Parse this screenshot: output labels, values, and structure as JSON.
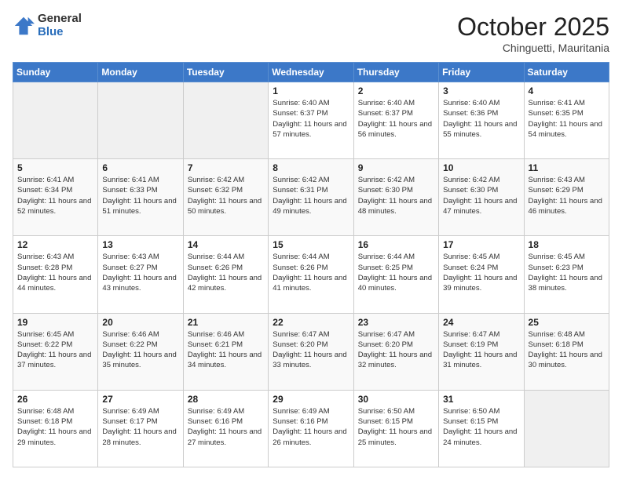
{
  "header": {
    "logo_general": "General",
    "logo_blue": "Blue",
    "month_title": "October 2025",
    "location": "Chinguetti, Mauritania"
  },
  "days_of_week": [
    "Sunday",
    "Monday",
    "Tuesday",
    "Wednesday",
    "Thursday",
    "Friday",
    "Saturday"
  ],
  "weeks": [
    [
      {
        "day": "",
        "empty": true
      },
      {
        "day": "",
        "empty": true
      },
      {
        "day": "",
        "empty": true
      },
      {
        "day": "1",
        "sunrise": "6:40 AM",
        "sunset": "6:37 PM",
        "daylight": "11 hours and 57 minutes."
      },
      {
        "day": "2",
        "sunrise": "6:40 AM",
        "sunset": "6:37 PM",
        "daylight": "11 hours and 56 minutes."
      },
      {
        "day": "3",
        "sunrise": "6:40 AM",
        "sunset": "6:36 PM",
        "daylight": "11 hours and 55 minutes."
      },
      {
        "day": "4",
        "sunrise": "6:41 AM",
        "sunset": "6:35 PM",
        "daylight": "11 hours and 54 minutes."
      }
    ],
    [
      {
        "day": "5",
        "sunrise": "6:41 AM",
        "sunset": "6:34 PM",
        "daylight": "11 hours and 52 minutes."
      },
      {
        "day": "6",
        "sunrise": "6:41 AM",
        "sunset": "6:33 PM",
        "daylight": "11 hours and 51 minutes."
      },
      {
        "day": "7",
        "sunrise": "6:42 AM",
        "sunset": "6:32 PM",
        "daylight": "11 hours and 50 minutes."
      },
      {
        "day": "8",
        "sunrise": "6:42 AM",
        "sunset": "6:31 PM",
        "daylight": "11 hours and 49 minutes."
      },
      {
        "day": "9",
        "sunrise": "6:42 AM",
        "sunset": "6:30 PM",
        "daylight": "11 hours and 48 minutes."
      },
      {
        "day": "10",
        "sunrise": "6:42 AM",
        "sunset": "6:30 PM",
        "daylight": "11 hours and 47 minutes."
      },
      {
        "day": "11",
        "sunrise": "6:43 AM",
        "sunset": "6:29 PM",
        "daylight": "11 hours and 46 minutes."
      }
    ],
    [
      {
        "day": "12",
        "sunrise": "6:43 AM",
        "sunset": "6:28 PM",
        "daylight": "11 hours and 44 minutes."
      },
      {
        "day": "13",
        "sunrise": "6:43 AM",
        "sunset": "6:27 PM",
        "daylight": "11 hours and 43 minutes."
      },
      {
        "day": "14",
        "sunrise": "6:44 AM",
        "sunset": "6:26 PM",
        "daylight": "11 hours and 42 minutes."
      },
      {
        "day": "15",
        "sunrise": "6:44 AM",
        "sunset": "6:26 PM",
        "daylight": "11 hours and 41 minutes."
      },
      {
        "day": "16",
        "sunrise": "6:44 AM",
        "sunset": "6:25 PM",
        "daylight": "11 hours and 40 minutes."
      },
      {
        "day": "17",
        "sunrise": "6:45 AM",
        "sunset": "6:24 PM",
        "daylight": "11 hours and 39 minutes."
      },
      {
        "day": "18",
        "sunrise": "6:45 AM",
        "sunset": "6:23 PM",
        "daylight": "11 hours and 38 minutes."
      }
    ],
    [
      {
        "day": "19",
        "sunrise": "6:45 AM",
        "sunset": "6:22 PM",
        "daylight": "11 hours and 37 minutes."
      },
      {
        "day": "20",
        "sunrise": "6:46 AM",
        "sunset": "6:22 PM",
        "daylight": "11 hours and 35 minutes."
      },
      {
        "day": "21",
        "sunrise": "6:46 AM",
        "sunset": "6:21 PM",
        "daylight": "11 hours and 34 minutes."
      },
      {
        "day": "22",
        "sunrise": "6:47 AM",
        "sunset": "6:20 PM",
        "daylight": "11 hours and 33 minutes."
      },
      {
        "day": "23",
        "sunrise": "6:47 AM",
        "sunset": "6:20 PM",
        "daylight": "11 hours and 32 minutes."
      },
      {
        "day": "24",
        "sunrise": "6:47 AM",
        "sunset": "6:19 PM",
        "daylight": "11 hours and 31 minutes."
      },
      {
        "day": "25",
        "sunrise": "6:48 AM",
        "sunset": "6:18 PM",
        "daylight": "11 hours and 30 minutes."
      }
    ],
    [
      {
        "day": "26",
        "sunrise": "6:48 AM",
        "sunset": "6:18 PM",
        "daylight": "11 hours and 29 minutes."
      },
      {
        "day": "27",
        "sunrise": "6:49 AM",
        "sunset": "6:17 PM",
        "daylight": "11 hours and 28 minutes."
      },
      {
        "day": "28",
        "sunrise": "6:49 AM",
        "sunset": "6:16 PM",
        "daylight": "11 hours and 27 minutes."
      },
      {
        "day": "29",
        "sunrise": "6:49 AM",
        "sunset": "6:16 PM",
        "daylight": "11 hours and 26 minutes."
      },
      {
        "day": "30",
        "sunrise": "6:50 AM",
        "sunset": "6:15 PM",
        "daylight": "11 hours and 25 minutes."
      },
      {
        "day": "31",
        "sunrise": "6:50 AM",
        "sunset": "6:15 PM",
        "daylight": "11 hours and 24 minutes."
      },
      {
        "day": "",
        "empty": true
      }
    ]
  ],
  "labels": {
    "sunrise_label": "Sunrise:",
    "sunset_label": "Sunset:",
    "daylight_label": "Daylight:"
  }
}
